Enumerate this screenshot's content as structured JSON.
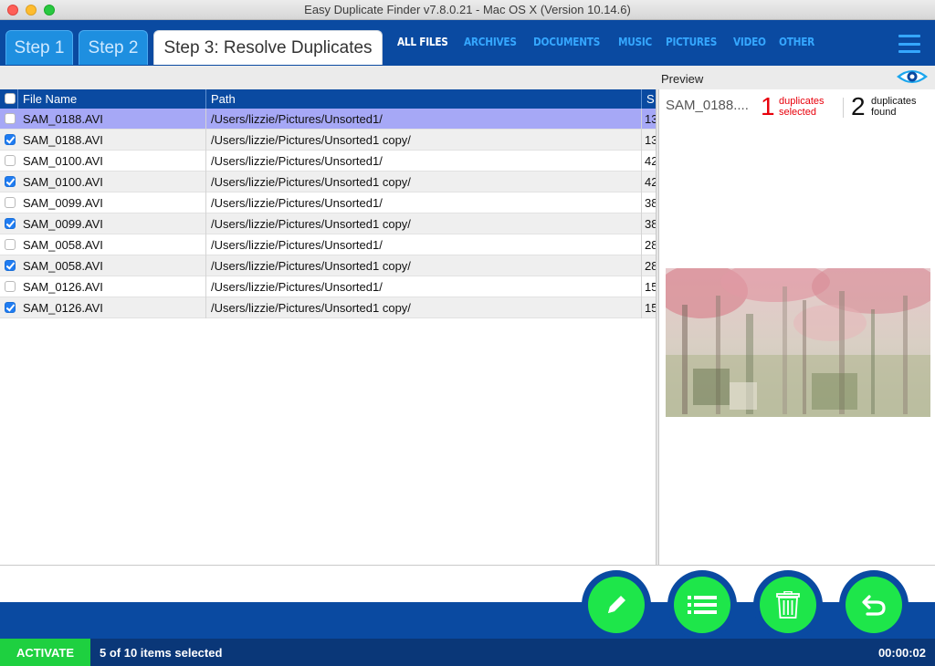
{
  "window": {
    "title": "Easy Duplicate Finder v7.8.0.21 - Mac OS X (Version 10.14.6)"
  },
  "steps": [
    {
      "label": "Step 1",
      "active": false
    },
    {
      "label": "Step 2",
      "active": false
    },
    {
      "label": "Step 3: Resolve Duplicates",
      "active": true
    }
  ],
  "filters": [
    {
      "label": "ALL FILES",
      "active": true
    },
    {
      "label": "ARCHIVES",
      "active": false
    },
    {
      "label": "DOCUMENTS",
      "active": false
    },
    {
      "label": "MUSIC",
      "active": false
    },
    {
      "label": "PICTURES",
      "active": false
    },
    {
      "label": "VIDEO",
      "active": false
    },
    {
      "label": "OTHER",
      "active": false
    }
  ],
  "table": {
    "columns": [
      "File Name",
      "Path",
      "S"
    ],
    "rows": [
      {
        "name": "SAM_0188.AVI",
        "path": "/Users/lizzie/Pictures/Unsorted1/",
        "size": "13",
        "checked": false,
        "selected": true
      },
      {
        "name": "SAM_0188.AVI",
        "path": "/Users/lizzie/Pictures/Unsorted1 copy/",
        "size": "13",
        "checked": true,
        "selected": false
      },
      {
        "name": "SAM_0100.AVI",
        "path": "/Users/lizzie/Pictures/Unsorted1/",
        "size": "42",
        "checked": false,
        "selected": false
      },
      {
        "name": "SAM_0100.AVI",
        "path": "/Users/lizzie/Pictures/Unsorted1 copy/",
        "size": "42",
        "checked": true,
        "selected": false
      },
      {
        "name": "SAM_0099.AVI",
        "path": "/Users/lizzie/Pictures/Unsorted1/",
        "size": "38",
        "checked": false,
        "selected": false
      },
      {
        "name": "SAM_0099.AVI",
        "path": "/Users/lizzie/Pictures/Unsorted1 copy/",
        "size": "38",
        "checked": true,
        "selected": false
      },
      {
        "name": "SAM_0058.AVI",
        "path": "/Users/lizzie/Pictures/Unsorted1/",
        "size": "28",
        "checked": false,
        "selected": false
      },
      {
        "name": "SAM_0058.AVI",
        "path": "/Users/lizzie/Pictures/Unsorted1 copy/",
        "size": "28",
        "checked": true,
        "selected": false
      },
      {
        "name": "SAM_0126.AVI",
        "path": "/Users/lizzie/Pictures/Unsorted1/",
        "size": "15",
        "checked": false,
        "selected": false
      },
      {
        "name": "SAM_0126.AVI",
        "path": "/Users/lizzie/Pictures/Unsorted1 copy/",
        "size": "15",
        "checked": true,
        "selected": false
      }
    ]
  },
  "preview": {
    "label": "Preview",
    "filename": "SAM_0188....",
    "selected_count": "1",
    "selected_text_1": "duplicates",
    "selected_text_2": "selected",
    "found_count": "2",
    "found_text_1": "duplicates",
    "found_text_2": "found",
    "eye_icon": "eye-icon"
  },
  "actions": [
    {
      "name": "pencil-icon"
    },
    {
      "name": "list-icon"
    },
    {
      "name": "trash-icon"
    },
    {
      "name": "undo-icon"
    }
  ],
  "status": {
    "activate_label": "ACTIVATE",
    "selection_text": "5 of 10 items selected",
    "timer": "00:00:02"
  },
  "colors": {
    "brand_blue": "#0a4aa1",
    "accent_green": "#1ee64a",
    "highlight_red": "#e8000b",
    "row_selected": "#a6a8f6"
  }
}
